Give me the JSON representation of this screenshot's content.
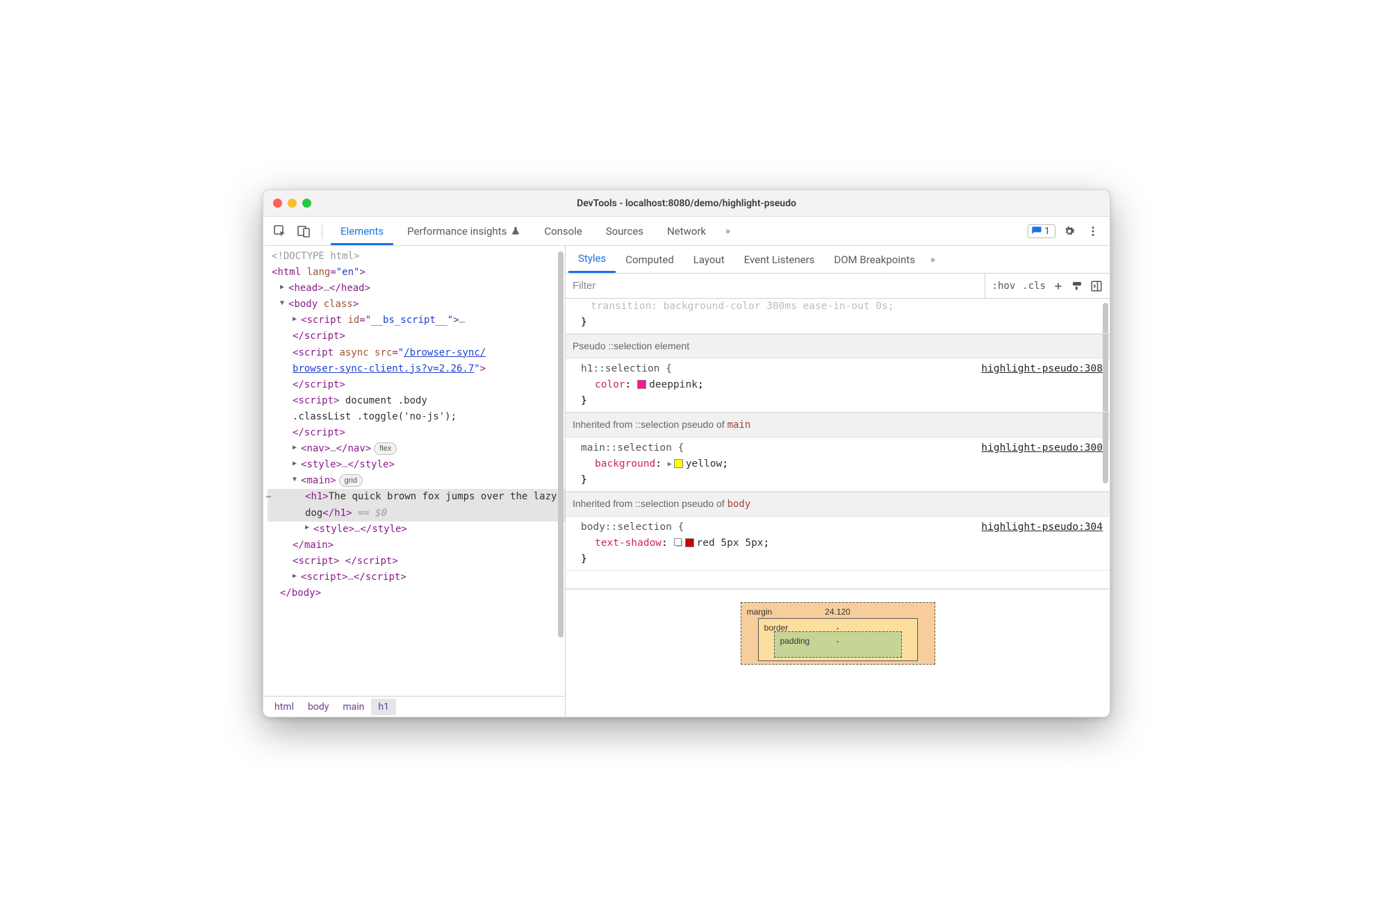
{
  "window": {
    "title": "DevTools - localhost:8080/demo/highlight-pseudo"
  },
  "toolbar": {
    "tabs": [
      "Elements",
      "Performance insights",
      "Console",
      "Sources",
      "Network"
    ],
    "active_tab": "Elements",
    "issues_count": "1"
  },
  "dom": {
    "doctype": "<!DOCTYPE html>",
    "html_open_tag": "html",
    "html_lang_attr": "lang",
    "html_lang_val": "\"en\"",
    "head": "head",
    "body_tag": "body",
    "body_class_attr": "class",
    "script1_id_attr": "id",
    "script1_id_val": "\"__bs_script__\"",
    "script2_async": "async",
    "script2_src_attr": "src",
    "script2_src_val_a": "/browser-sync/",
    "script2_src_val_b": "browser-sync-client.js?v=2.26.7",
    "script3_text_a": " document .body",
    "script3_text_b": ".classList .toggle('no-js');",
    "nav_tag": "nav",
    "nav_pill": "flex",
    "style_tag": "style",
    "main_tag": "main",
    "main_pill": "grid",
    "h1_tag": "h1",
    "h1_text_a": "The quick brown fox jumps",
    "h1_text_b": "over the lazy dog",
    "eq0": " == $0",
    "script_tag": "script",
    "ellipsis": "…"
  },
  "breadcrumb": {
    "items": [
      "html",
      "body",
      "main",
      "h1"
    ],
    "selected": 3
  },
  "styles": {
    "sub_tabs": [
      "Styles",
      "Computed",
      "Layout",
      "Event Listeners",
      "DOM Breakpoints"
    ],
    "active_sub_tab": "Styles",
    "filter_placeholder": "Filter",
    "hov": ":hov",
    "cls": ".cls",
    "partial_line": "transition:  background-color 300ms  ease-in-out 0s;",
    "section_selection": "Pseudo ::selection element",
    "rule1": {
      "selector": "h1::selection {",
      "source": "highlight-pseudo:308",
      "prop": "color",
      "val": "deeppink",
      "swatch": "#ff1493"
    },
    "section_inherit_main_a": "Inherited from ::selection pseudo of ",
    "section_inherit_main_b": "main",
    "rule2": {
      "selector": "main::selection {",
      "source": "highlight-pseudo:300",
      "prop": "background",
      "val": "yellow",
      "swatch": "#ffff00"
    },
    "section_inherit_body_a": "Inherited from ::selection pseudo of ",
    "section_inherit_body_b": "body",
    "rule3": {
      "selector": "body::selection {",
      "source": "highlight-pseudo:304",
      "prop": "text-shadow",
      "val": "red 5px 5px",
      "swatch": "#cc0000"
    },
    "close_brace": "}"
  },
  "boxmodel": {
    "margin_label": "margin",
    "margin_top": "24.120",
    "border_label": "border",
    "border_top": "-",
    "padding_label": "padding",
    "padding_top": "-"
  }
}
